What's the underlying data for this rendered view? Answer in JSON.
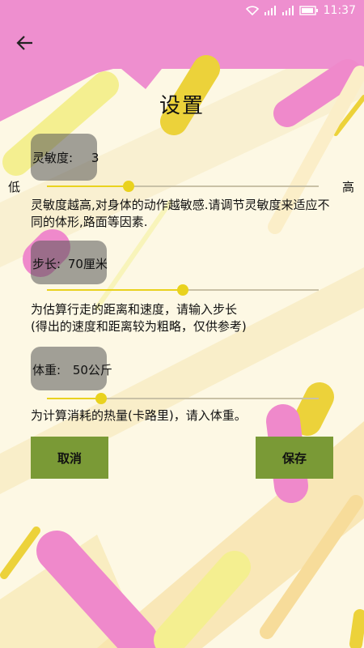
{
  "status_bar": {
    "time": "11:37"
  },
  "page": {
    "title": "设置"
  },
  "sensitivity": {
    "label": "灵敏度:",
    "value": "3",
    "min_label": "低",
    "max_label": "高",
    "level": 0.3,
    "description": "灵敏度越高,对身体的动作越敏感.请调节灵敏度来适应不同的体形,路面等因素."
  },
  "step_length": {
    "label": "步长:",
    "value": "70厘米",
    "level": 0.5,
    "description_line1": "为估算行走的距离和速度，请输入步长",
    "description_line2": "(得出的速度和距离较为粗略，仅供参考)"
  },
  "weight": {
    "label": "体重:",
    "value": "50公斤",
    "level": 0.2,
    "description": "为计算消耗的热量(卡路里)，请入体重。"
  },
  "buttons": {
    "cancel": "取消",
    "save": "保存"
  },
  "colors": {
    "header": "#ee8fcf",
    "background": "#fdf8e4",
    "accent": "#e9d21e",
    "button": "#7a9a36"
  }
}
